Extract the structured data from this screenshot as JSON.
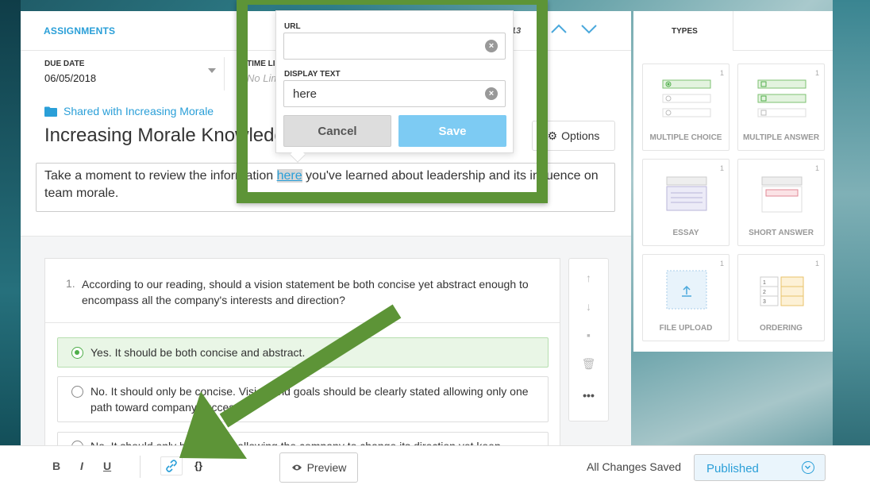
{
  "header": {
    "tab_label": "ASSIGNMENTS",
    "count": "13"
  },
  "due": {
    "label": "DUE DATE",
    "value": "06/05/2018",
    "time_label": "TIME LIMIT",
    "time_placeholder": "No Limit"
  },
  "assignment": {
    "folder": "Shared with Increasing Morale",
    "title": "Increasing Morale Knowledge",
    "options_label": "Options",
    "description_before": "Take a moment to review the information ",
    "description_link": "here",
    "description_after": " you've learned about leadership and its influence on team morale."
  },
  "question": {
    "number": "1.",
    "text": "According to our reading, should a vision statement be both concise yet abstract enough to encompass all the company's interests and direction?",
    "options": [
      {
        "text": "Yes. It should be both concise and abstract.",
        "correct": true
      },
      {
        "text": "No. It should only be concise. Vision and goals should be clearly stated allowing only one path toward company success.",
        "correct": false
      },
      {
        "text": "No. It should only be abstract allowing the company to change its direction yet keep",
        "correct": false
      }
    ]
  },
  "link_popover": {
    "url_label": "URL",
    "url_value": "",
    "display_label": "DISPLAY TEXT",
    "display_value": "here",
    "cancel_label": "Cancel",
    "save_label": "Save"
  },
  "types_panel": {
    "tab_label": "TYPES",
    "cards": [
      {
        "label": "MULTIPLE CHOICE",
        "count": "1",
        "icon": "multiple-choice-icon"
      },
      {
        "label": "MULTIPLE ANSWER",
        "count": "1",
        "icon": "multiple-answer-icon"
      },
      {
        "label": "ESSAY",
        "count": "1",
        "icon": "essay-icon"
      },
      {
        "label": "SHORT ANSWER",
        "count": "1",
        "icon": "short-answer-icon"
      },
      {
        "label": "FILE UPLOAD",
        "count": "1",
        "icon": "file-upload-icon"
      },
      {
        "label": "ORDERING",
        "count": "1",
        "icon": "ordering-icon"
      }
    ]
  },
  "toolbar": {
    "bold": "B",
    "italic": "I",
    "underline": "U",
    "code": "{}",
    "preview_label": "Preview",
    "saved_text": "All Changes Saved",
    "status_value": "Published"
  },
  "colors": {
    "accent": "#2a9fd8",
    "annotation_green": "#5d9437",
    "correct_green": "#4fae4a",
    "save_button": "#7dcbf3"
  }
}
